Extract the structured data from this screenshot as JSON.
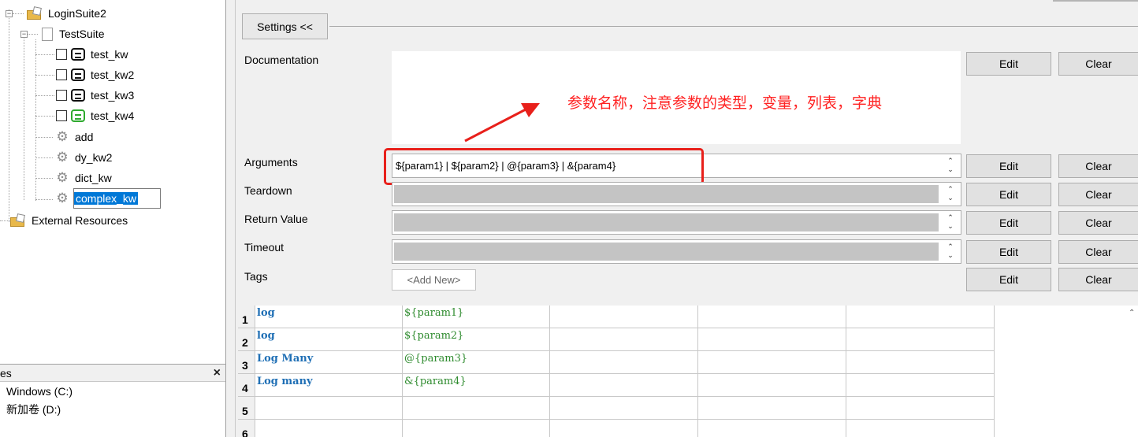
{
  "tree": {
    "items": [
      {
        "label": "LoginSuite2"
      },
      {
        "label": "TestSuite"
      },
      {
        "label": "test_kw"
      },
      {
        "label": "test_kw2"
      },
      {
        "label": "test_kw3"
      },
      {
        "label": "test_kw4"
      },
      {
        "label": "add"
      },
      {
        "label": "dy_kw2"
      },
      {
        "label": "dict_kw"
      },
      {
        "label": "complex_kw"
      },
      {
        "label": "External Resources"
      }
    ]
  },
  "files_panel": {
    "title": "es",
    "close": "×",
    "drives": [
      "Windows (C:)",
      "新加卷 (D:)"
    ]
  },
  "settings": {
    "toggle_label": "Settings <<",
    "fields": {
      "documentation": "Documentation",
      "arguments": "Arguments",
      "teardown": "Teardown",
      "return_value": "Return Value",
      "timeout": "Timeout",
      "tags": "Tags"
    },
    "arguments_value": "${param1} | ${param2} | @{param3} | &{param4}",
    "tags_placeholder": "<Add New>",
    "edit_label": "Edit",
    "clear_label": "Clear"
  },
  "annotation": {
    "text": "参数名称，注意参数的类型，变量，列表，字典",
    "color": "#ff2222"
  },
  "grid": {
    "rows": [
      {
        "num": "1",
        "keyword": "log",
        "arg": "${param1}"
      },
      {
        "num": "2",
        "keyword": "log",
        "arg": "${param2}"
      },
      {
        "num": "3",
        "keyword": "Log Many",
        "arg": "@{param3}"
      },
      {
        "num": "4",
        "keyword": "Log many",
        "arg": "&{param4}"
      },
      {
        "num": "5",
        "keyword": "",
        "arg": ""
      },
      {
        "num": "6",
        "keyword": "",
        "arg": ""
      }
    ]
  }
}
